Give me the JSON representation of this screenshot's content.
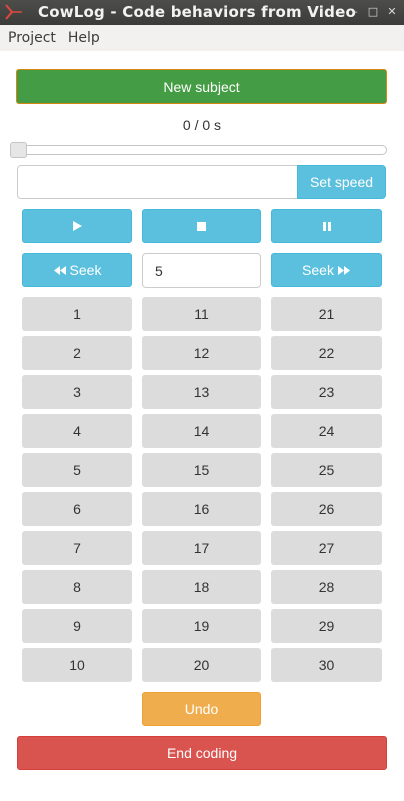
{
  "window": {
    "title": "CowLog - Code behaviors from Video",
    "controls": [
      "–",
      "□",
      "✕"
    ]
  },
  "menu": {
    "items": [
      "Project",
      "Help"
    ]
  },
  "subject": {
    "new_label": "New subject"
  },
  "playback": {
    "time_display": "0 / 0 s",
    "position": 0.0
  },
  "speed": {
    "value": "",
    "button_label": "Set speed"
  },
  "transport": {
    "play_icon": "play-icon",
    "stop_icon": "stop-icon",
    "pause_icon": "pause-icon"
  },
  "seek": {
    "back_label": "Seek",
    "forward_label": "Seek",
    "step_value": "5"
  },
  "codes": {
    "col1": [
      "1",
      "2",
      "3",
      "4",
      "5",
      "6",
      "7",
      "8",
      "9",
      "10"
    ],
    "col2": [
      "11",
      "12",
      "13",
      "14",
      "15",
      "16",
      "17",
      "18",
      "19",
      "20"
    ],
    "col3": [
      "21",
      "22",
      "23",
      "24",
      "25",
      "26",
      "27",
      "28",
      "29",
      "30"
    ]
  },
  "actions": {
    "undo_label": "Undo",
    "end_label": "End coding"
  },
  "colors": {
    "success": "#449d44",
    "info": "#5bc0de",
    "default": "#dcdcdc",
    "warning": "#f0ad4e",
    "danger": "#d9534f"
  }
}
